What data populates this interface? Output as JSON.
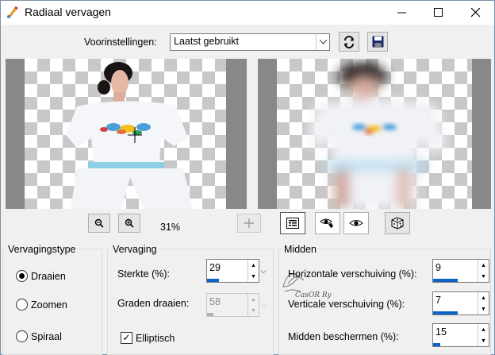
{
  "window": {
    "title": "Radiaal vervagen"
  },
  "presets": {
    "label": "Voorinstellingen:",
    "selected": "Laatst gebruikt"
  },
  "zoom": {
    "value": "31%"
  },
  "blur_type": {
    "title": "Vervagingstype",
    "options": [
      "Draaien",
      "Zoomen",
      "Spiraal"
    ],
    "selected": "Draaien"
  },
  "blur": {
    "title": "Vervaging",
    "strength_label": "Sterkte (%):",
    "strength_value": "29",
    "strength_fraction": 0.29,
    "degrees_label": "Graden draaien:",
    "degrees_value": "58",
    "degrees_fraction": 0.16,
    "elliptic_label": "Elliptisch",
    "elliptic_checked": true
  },
  "center": {
    "title": "Midden",
    "h_label": "Horizontale verschuiving (%):",
    "h_value": "9",
    "h_fraction": 0.55,
    "v_label": "Verticale verschuiving (%):",
    "v_value": "7",
    "v_fraction": 0.54,
    "protect_label": "Midden beschermen (%):",
    "protect_value": "15",
    "protect_fraction": 0.15
  },
  "watermark": {
    "text": "CasOR Ry"
  },
  "colors": {
    "accent": "#0a64c8",
    "preview_bg": "#888888"
  }
}
